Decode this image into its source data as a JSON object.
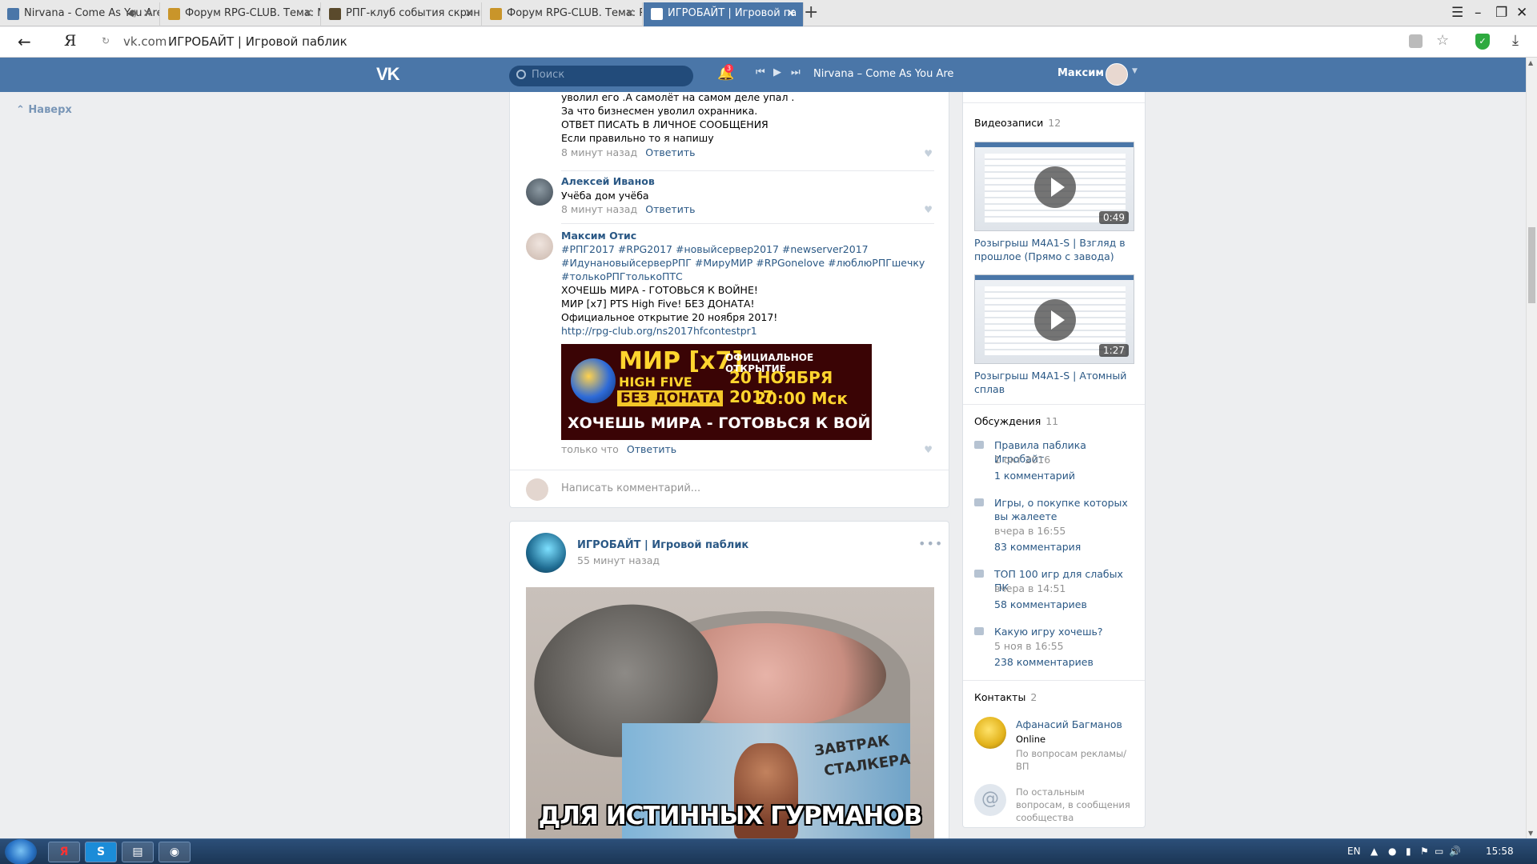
{
  "browser": {
    "tabs": [
      {
        "title": "Nirvana - Come As You Are",
        "active": false,
        "sound": true
      },
      {
        "title": "Форум RPG-CLUB. Тема: Ми",
        "active": false
      },
      {
        "title": "РПГ-клуб события скриншо",
        "active": false
      },
      {
        "title": "Форум RPG-CLUB. Тема: RP",
        "active": false
      },
      {
        "title": "ИГРОБАЙТ | Игровой па",
        "active": true
      }
    ],
    "new_tab_glyph": "+",
    "window_controls": [
      "☰",
      "–",
      "❐",
      "✕"
    ],
    "back_glyph": "←",
    "yandex_glyph": "Я",
    "reload_glyph": "↻",
    "url": "vk.com",
    "page_title": "ИГРОБАЙТ | Игровой паблик",
    "star_glyph": "☆",
    "download_glyph": "⤓",
    "shield_glyph": "✓"
  },
  "vk": {
    "logo": "VK",
    "search_placeholder": "Поиск",
    "notif_count": "3",
    "bell_glyph": "🔔",
    "player": {
      "prev": "⏮",
      "play": "▶",
      "next": "⏭",
      "track": "Nirvana – Come As You Are"
    },
    "user_name": "Максим",
    "caret": "▼",
    "up_label": "⌃  Наверх"
  },
  "comments": [
    {
      "lines": [
        "уволил его .А самолёт на самом деле упал .",
        "За что бизнесмен уволил охранника.",
        "ОТВЕТ ПИСАТЬ В ЛИЧНОЕ СООБЩЕНИЯ",
        "Если правильно то я напишу"
      ],
      "time": "8 минут назад",
      "reply": "Ответить"
    },
    {
      "author": "Алексей Иванов",
      "text": "Учёба дом учёба",
      "time": "8 минут назад",
      "reply": "Ответить"
    },
    {
      "author": "Максим Отис",
      "hashtags": [
        "#РПГ2017 #RPG2017 #новыйсервер2017 #newserver2017",
        "#ИдунановыйсерверРПГ #МируМИР #RPGonelove #люблюРПГшечку",
        "#толькоРПГтолькоПТС"
      ],
      "lines": [
        "ХОЧЕШЬ МИРА - ГОТОВЬСЯ К ВОЙНЕ!",
        "МИР [x7] PTS High Five! БЕЗ ДОНАТА!",
        "Официальное открытие 20 ноября 2017!"
      ],
      "link": "http://rpg-club.org/ns2017hfcontestpr1",
      "banner": {
        "mir": "МИР [x7]",
        "hf": "HIGH FIVE",
        "bez": "БЕЗ ДОНАТА",
        "open": "ОФИЦИАЛЬНОЕ ОТКРЫТИЕ",
        "date": "20 НОЯБРЯ 2017",
        "time": "20:00 Мск",
        "motto": "ХОЧЕШЬ МИРА - ГОТОВЬСЯ К ВОЙНЕ"
      },
      "time": "только что",
      "reply": "Ответить"
    }
  ],
  "heart_glyph": "♥",
  "write_placeholder": "Написать комментарий...",
  "post": {
    "author": "ИГРОБАЙТ | Игровой паблик",
    "time": "55 минут назад",
    "menu_glyph": "•••",
    "image_text": {
      "label_line1": "ЗАВТРАК",
      "label_line2": "СТАЛКЕРА",
      "caption": "ДЛЯ ИСТИННЫХ ГУРМАНОВ"
    }
  },
  "sidebar": {
    "videos": {
      "title": "Видеозаписи",
      "count": "12",
      "items": [
        {
          "duration": "0:49",
          "title": "Розыгрыш M4A1-S | Взгляд в прошлое (Прямо с завода)"
        },
        {
          "duration": "1:27",
          "title": "Розыгрыш M4A1-S | Атомный сплав"
        }
      ]
    },
    "discussions": {
      "title": "Обсуждения",
      "count": "11",
      "items": [
        {
          "title": "Правила паблика Игробайт",
          "date": "1 окт 2016",
          "comments": "1 комментарий"
        },
        {
          "title": "Игры, о покупке которых вы жалеете",
          "date": "вчера в 16:55",
          "comments": "83 комментария"
        },
        {
          "title": "ТОП 100 игр для слабых ПК",
          "date": "вчера в 14:51",
          "comments": "58 комментариев"
        },
        {
          "title": "Какую игру хочешь?",
          "date": "5 ноя в 16:55",
          "comments": "238 комментариев"
        }
      ]
    },
    "contacts": {
      "title": "Контакты",
      "count": "2",
      "items": [
        {
          "name": "Афанасий Багманов",
          "status": "Online",
          "desc": "По вопросам рекламы/ ВП"
        },
        {
          "icon": "@",
          "desc": "По остальным вопросам, в сообщения сообщества"
        }
      ]
    }
  },
  "taskbar": {
    "apps": [
      "Я",
      "S",
      "▤",
      "◉"
    ],
    "lang": "EN",
    "clock": "15:58",
    "tray_up": "▲",
    "tray_icons": [
      "●",
      "▮",
      "⚑",
      "▭",
      "🔊"
    ]
  }
}
